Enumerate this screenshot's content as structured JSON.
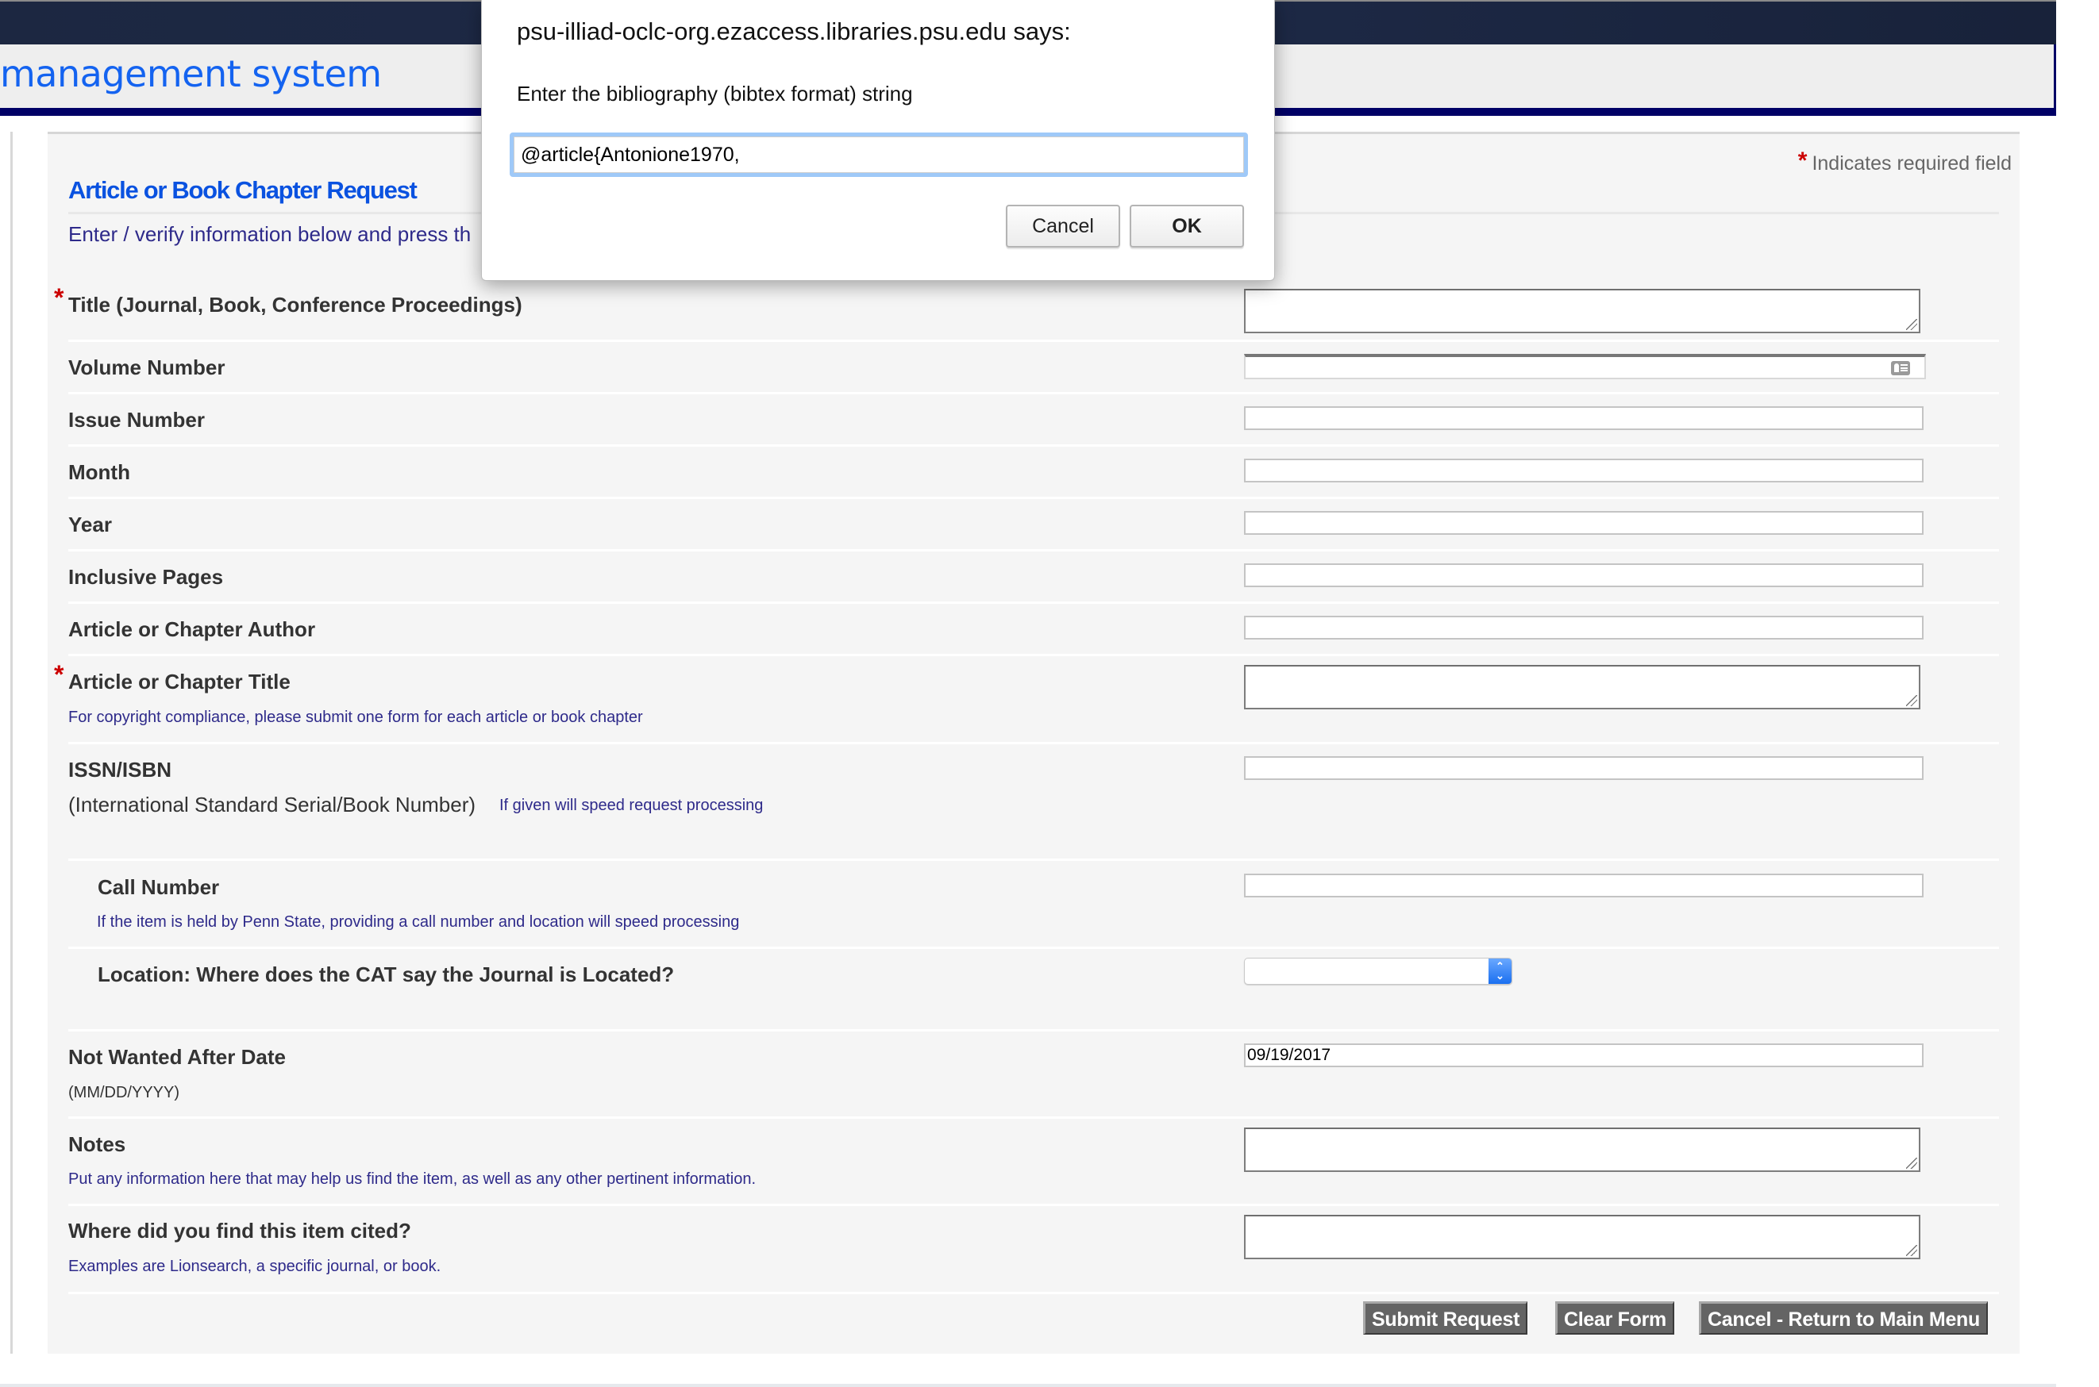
{
  "header": {
    "title": "management system"
  },
  "dialog": {
    "title": "psu-illiad-oclc-org.ezaccess.libraries.psu.edu says:",
    "message": "Enter the bibliography (bibtex format) string",
    "input_value": "@article{Antonione1970,",
    "cancel_label": "Cancel",
    "ok_label": "OK"
  },
  "form": {
    "required_note": "Indicates required field",
    "required_marker": "*",
    "title": "Article or Book Chapter Request",
    "instructions": "Enter / verify information below and press th",
    "fields": {
      "journal_title": {
        "label": "Title (Journal, Book, Conference Proceedings)",
        "required": true,
        "value": ""
      },
      "volume": {
        "label": "Volume Number",
        "value": ""
      },
      "issue": {
        "label": "Issue Number",
        "value": ""
      },
      "month": {
        "label": "Month",
        "value": ""
      },
      "year": {
        "label": "Year",
        "value": ""
      },
      "pages": {
        "label": "Inclusive Pages",
        "value": ""
      },
      "author": {
        "label": "Article or Chapter Author",
        "value": ""
      },
      "article_title": {
        "label": "Article or Chapter Title",
        "required": true,
        "hint": "For copyright compliance, please submit one form for each article or book chapter",
        "value": ""
      },
      "issn": {
        "label": "ISSN/ISBN",
        "sublabel": "(International Standard Serial/Book Number)",
        "hint": "If given will speed request processing",
        "value": ""
      },
      "call_number": {
        "label": "Call Number",
        "hint": "If the item is held by Penn State, providing a call number and location will speed processing",
        "value": ""
      },
      "location": {
        "label": "Location: Where does the CAT say the Journal is Located?",
        "selected": ""
      },
      "not_wanted_after": {
        "label": "Not Wanted After Date",
        "sublabel": "(MM/DD/YYYY)",
        "value": "09/19/2017"
      },
      "notes": {
        "label": "Notes",
        "hint": "Put any information here that may help us find the item, as well as any other pertinent information.",
        "value": ""
      },
      "cited_in": {
        "label": "Where did you find this item cited?",
        "hint": "Examples are Lionsearch, a specific journal, or book.",
        "value": ""
      }
    },
    "buttons": {
      "submit": "Submit Request",
      "clear": "Clear Form",
      "cancel": "Cancel - Return to Main Menu"
    }
  },
  "colors": {
    "header_navy": "#000066",
    "title_blue": "#0a52e0",
    "hint_navy": "#2e2a8a",
    "required_red": "#cc0000",
    "button_gray": "#646464"
  }
}
